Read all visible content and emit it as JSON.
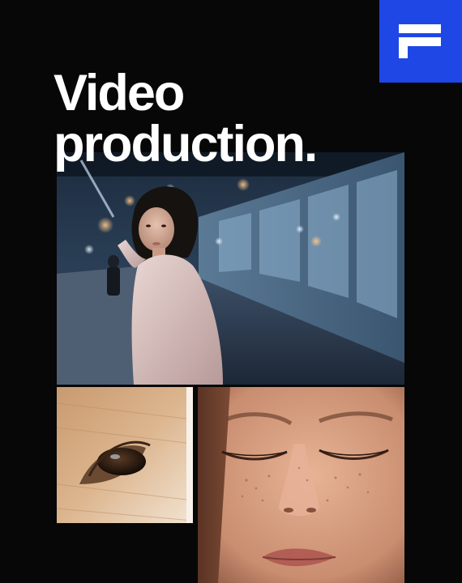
{
  "headline": {
    "line1": "Video",
    "line2": "production."
  },
  "logo": {
    "icon": "brand-f-logo-icon",
    "color": "#1f47e6"
  },
  "photos": [
    {
      "name": "night-street-portrait-photo"
    },
    {
      "name": "horse-eye-closeup-photo"
    },
    {
      "name": "freckled-face-closeup-photo"
    }
  ],
  "colors": {
    "background": "#070707",
    "text": "#ffffff",
    "accent": "#1f47e6"
  }
}
